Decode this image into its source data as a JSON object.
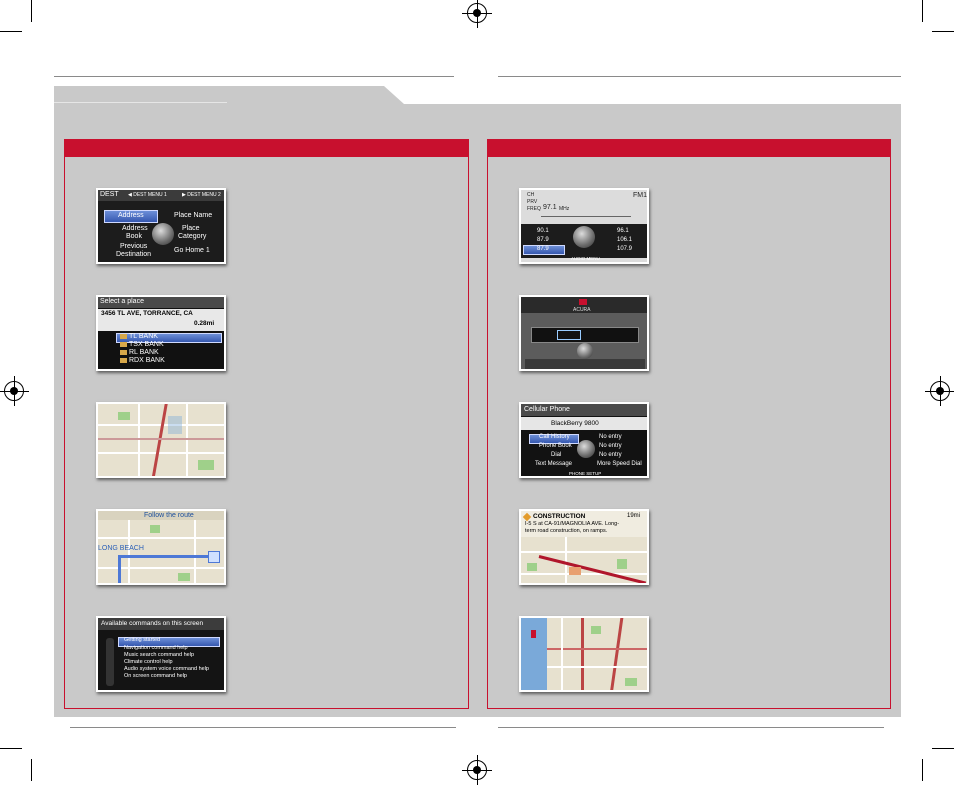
{
  "colors": {
    "accent_red": "#c8102e",
    "panel_gray": "#c9c9c9"
  },
  "shots": {
    "dest_menu": {
      "top": "DEST",
      "menu1": "◀ DEST MENU 1",
      "menu2": "▶ DEST MENU 2",
      "address": "Address",
      "place_name": "Place Name",
      "address_book_1": "Address",
      "address_book_2": "Book",
      "place_category_1": "Place",
      "place_category_2": "Category",
      "previous_1": "Previous",
      "previous_2": "Destination",
      "go_home": "Go Home 1"
    },
    "select_place": {
      "title": "Select a place",
      "address": "3456 TL AVE, TORRANCE, CA",
      "distance": "0.28mi",
      "items": [
        "TL BANK",
        "TSX BANK",
        "RL BANK",
        "RDX BANK"
      ]
    },
    "map_route": {
      "banner": "Follow the route",
      "city": "LONG BEACH"
    },
    "voice_help": {
      "title": "Available commands on this screen",
      "items": [
        "Getting started",
        "Navigation command help",
        "Music search command help",
        "Climate control help",
        "Audio system voice command help",
        "On screen command help"
      ]
    },
    "audio": {
      "band": "FM1",
      "freq_label": "FREQ",
      "freq": "97.1",
      "unit": "MHz",
      "left_tab1": "CH",
      "left_tab2": "PRV",
      "presets_left": [
        "90.1",
        "87.9",
        "87.9"
      ],
      "presets_right": [
        "96.1",
        "106.1",
        "107.9"
      ],
      "footer": "AUDIO MENU"
    },
    "dash": {
      "brand": "ACURA"
    },
    "phone": {
      "title": "Cellular Phone",
      "device": "BlackBerry 9800",
      "items": [
        "Call History",
        "Phone Book",
        "Dial",
        "Text Message"
      ],
      "values": [
        "No entry",
        "No entry",
        "No entry",
        "More Speed Dial"
      ],
      "footer": "PHONE SETUP"
    },
    "traffic": {
      "title": "CONSTRUCTION",
      "dist": "19mi",
      "line1": "I-5 S at CA-91/MAGNOLIA AVE. Long-",
      "line2": "term road construction, on ramps."
    }
  }
}
